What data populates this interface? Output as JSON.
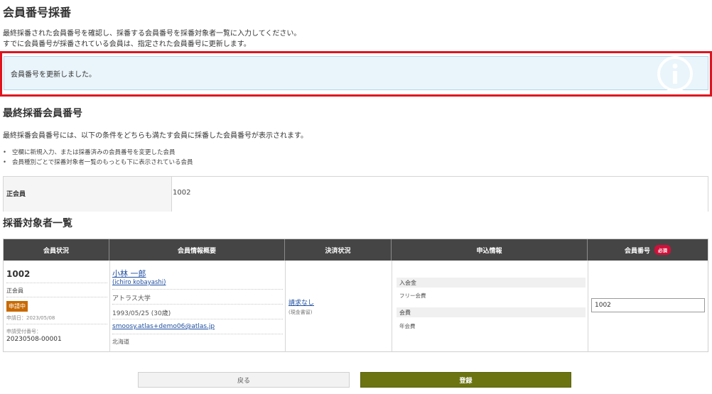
{
  "page": {
    "title": "会員番号採番",
    "description_line1": "最終採番された会員番号を確認し、採番する会員番号を採番対象者一覧に入力してください。",
    "description_line2": "すでに会員番号が採番されている会員は、指定された会員番号に更新します。"
  },
  "alert": {
    "message": "会員番号を更新しました。",
    "icon": "info-icon"
  },
  "last_number": {
    "section_title": "最終採番会員番号",
    "note": "最終採番会員番号には、以下の条件をどちらも満たす会員に採番した会員番号が表示されます。",
    "conditions": [
      "空欄に新規入力、または採番済みの会員番号を変更した会員",
      "会員種別ごとで採番対象者一覧のもっとも下に表示されている会員"
    ],
    "row_label": "正会員",
    "row_value": "1002"
  },
  "targets": {
    "section_title": "採番対象者一覧",
    "headers": {
      "status": "会員状況",
      "overview": "会員情報概要",
      "payment": "決済状況",
      "application": "申込情報",
      "member_no": "会員番号",
      "required_badge": "必須"
    },
    "rows": [
      {
        "member_no": "1002",
        "member_type": "正会員",
        "status": "申請中",
        "apply_date": "申請日：2023/05/08",
        "receipt_label": "申請受付番号：",
        "receipt_no": "20230508-00001",
        "name": "小林 一郎",
        "name_kana": "(ichiro kobayashi)",
        "organization": "アトラス大学",
        "birth": "1993/05/25 (30歳)",
        "email": "smoosy.atlas+demo06@atlas.jp",
        "prefecture": "北海道",
        "payment_status": "請求なし",
        "payment_sub": "(現金書留)",
        "app_head1": "入会金",
        "app_val1": "フリー会費",
        "app_head2": "会費",
        "app_val2": "年会費",
        "input_value": "1002"
      }
    ]
  },
  "buttons": {
    "back": "戻る",
    "submit": "登録"
  },
  "colors": {
    "header_bg": "#454545",
    "alert_bg": "#eaf5fb",
    "alert_frame": "#e0141e",
    "status_badge": "#c86a00",
    "required_badge": "#d0103a",
    "submit_bg": "#6b7411",
    "link": "#1f4fa0"
  }
}
